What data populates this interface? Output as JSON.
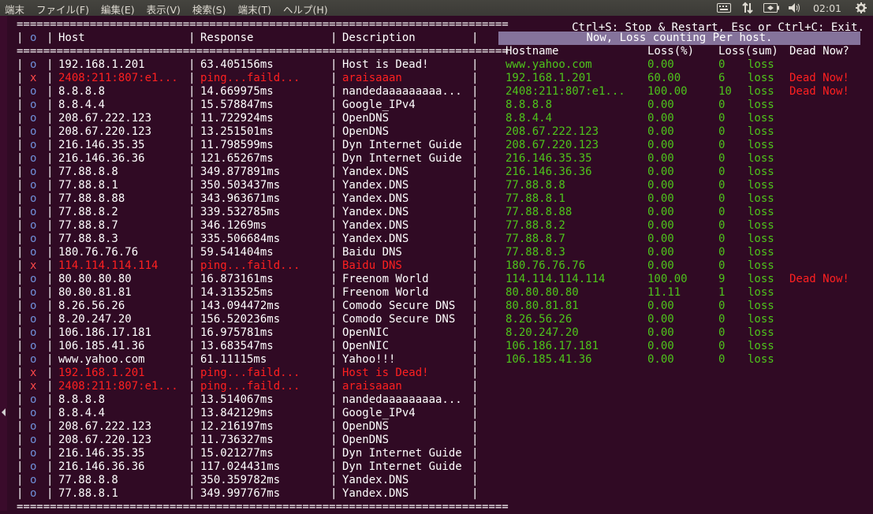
{
  "menubar": {
    "items": [
      "端末",
      "ファイル(F)",
      "編集(E)",
      "表示(V)",
      "検索(S)",
      "端末(T)",
      "ヘルプ(H)"
    ],
    "clock": "02:01"
  },
  "left_table": {
    "separator": "==========================================================================",
    "headers": {
      "mark": "o",
      "host": "Host",
      "response": "Response",
      "description": "Description"
    },
    "rows": [
      {
        "mark": "o",
        "host": "192.168.1.201",
        "response": "63.405156ms",
        "description": "Host is Dead!",
        "dead": false
      },
      {
        "mark": "x",
        "host": "2408:211:807:e1...",
        "response": "ping...faild...",
        "description": "araisaaan",
        "dead": true
      },
      {
        "mark": "o",
        "host": "8.8.8.8",
        "response": "14.669975ms",
        "description": "nandedaaaaaaaaa...",
        "dead": false
      },
      {
        "mark": "o",
        "host": "8.8.4.4",
        "response": "15.578847ms",
        "description": "Google_IPv4",
        "dead": false
      },
      {
        "mark": "o",
        "host": "208.67.222.123",
        "response": "11.722924ms",
        "description": "OpenDNS",
        "dead": false
      },
      {
        "mark": "o",
        "host": "208.67.220.123",
        "response": "13.251501ms",
        "description": "OpenDNS",
        "dead": false
      },
      {
        "mark": "o",
        "host": "216.146.35.35",
        "response": "11.798599ms",
        "description": "Dyn Internet Guide",
        "dead": false
      },
      {
        "mark": "o",
        "host": "216.146.36.36",
        "response": "121.65267ms",
        "description": "Dyn Internet Guide",
        "dead": false
      },
      {
        "mark": "o",
        "host": "77.88.8.8",
        "response": "349.877891ms",
        "description": "Yandex.DNS",
        "dead": false
      },
      {
        "mark": "o",
        "host": "77.88.8.1",
        "response": "350.503437ms",
        "description": "Yandex.DNS",
        "dead": false
      },
      {
        "mark": "o",
        "host": "77.88.8.88",
        "response": "343.963671ms",
        "description": "Yandex.DNS",
        "dead": false
      },
      {
        "mark": "o",
        "host": "77.88.8.2",
        "response": "339.532785ms",
        "description": "Yandex.DNS",
        "dead": false
      },
      {
        "mark": "o",
        "host": "77.88.8.7",
        "response": "346.1269ms",
        "description": "Yandex.DNS",
        "dead": false
      },
      {
        "mark": "o",
        "host": "77.88.8.3",
        "response": "335.506684ms",
        "description": "Yandex.DNS",
        "dead": false
      },
      {
        "mark": "o",
        "host": "180.76.76.76",
        "response": "59.541404ms",
        "description": "Baidu DNS",
        "dead": false
      },
      {
        "mark": "x",
        "host": "114.114.114.114",
        "response": "ping...faild...",
        "description": "Baidu DNS",
        "dead": true
      },
      {
        "mark": "o",
        "host": "80.80.80.80",
        "response": "16.873161ms",
        "description": "Freenom World",
        "dead": false
      },
      {
        "mark": "o",
        "host": "80.80.81.81",
        "response": "14.313525ms",
        "description": "Freenom World",
        "dead": false
      },
      {
        "mark": "o",
        "host": "8.26.56.26",
        "response": "143.094472ms",
        "description": "Comodo Secure DNS",
        "dead": false
      },
      {
        "mark": "o",
        "host": "8.20.247.20",
        "response": "156.520236ms",
        "description": "Comodo Secure DNS",
        "dead": false
      },
      {
        "mark": "o",
        "host": "106.186.17.181",
        "response": "16.975781ms",
        "description": "OpenNIC",
        "dead": false
      },
      {
        "mark": "o",
        "host": "106.185.41.36",
        "response": "13.683547ms",
        "description": "OpenNIC",
        "dead": false
      },
      {
        "mark": "o",
        "host": "www.yahoo.com",
        "response": "61.11115ms",
        "description": "Yahoo!!!",
        "dead": false
      },
      {
        "mark": "x",
        "host": "192.168.1.201",
        "response": "ping...faild...",
        "description": "Host is Dead!",
        "dead": true
      },
      {
        "mark": "x",
        "host": "2408:211:807:e1...",
        "response": "ping...faild...",
        "description": "araisaaan",
        "dead": true
      },
      {
        "mark": "o",
        "host": "8.8.8.8",
        "response": "13.514067ms",
        "description": "nandedaaaaaaaaa...",
        "dead": false
      },
      {
        "mark": "o",
        "host": "8.8.4.4",
        "response": "13.842129ms",
        "description": "Google_IPv4",
        "dead": false
      },
      {
        "mark": "o",
        "host": "208.67.222.123",
        "response": "12.216197ms",
        "description": "OpenDNS",
        "dead": false
      },
      {
        "mark": "o",
        "host": "208.67.220.123",
        "response": "11.736327ms",
        "description": "OpenDNS",
        "dead": false
      },
      {
        "mark": "o",
        "host": "216.146.35.35",
        "response": "15.021277ms",
        "description": "Dyn Internet Guide",
        "dead": false
      },
      {
        "mark": "o",
        "host": "216.146.36.36",
        "response": "117.024431ms",
        "description": "Dyn Internet Guide",
        "dead": false
      },
      {
        "mark": "o",
        "host": "77.88.8.8",
        "response": "350.359782ms",
        "description": "Yandex.DNS",
        "dead": false
      },
      {
        "mark": "o",
        "host": "77.88.8.1",
        "response": "349.997767ms",
        "description": "Yandex.DNS",
        "dead": false
      }
    ]
  },
  "right_panel": {
    "shortcut_text": "Ctrl+S: Stop & Restart, Esc or Ctrl+C: Exit.",
    "banner": "Now, Loss counting Per host.",
    "headers": {
      "hostname": "Hostname",
      "loss_pct": "Loss(%)",
      "loss_sum": "Loss(sum)",
      "dead_now": "Dead Now?"
    },
    "rows": [
      {
        "hostname": "www.yahoo.com",
        "loss_pct": "0.00",
        "loss_sum": "0",
        "unit": "loss",
        "dead_now": ""
      },
      {
        "hostname": "192.168.1.201",
        "loss_pct": "60.00",
        "loss_sum": "6",
        "unit": "loss",
        "dead_now": "Dead Now!"
      },
      {
        "hostname": "2408:211:807:e1...",
        "loss_pct": "100.00",
        "loss_sum": "10",
        "unit": "loss",
        "dead_now": "Dead Now!"
      },
      {
        "hostname": "8.8.8.8",
        "loss_pct": "0.00",
        "loss_sum": "0",
        "unit": "loss",
        "dead_now": ""
      },
      {
        "hostname": "8.8.4.4",
        "loss_pct": "0.00",
        "loss_sum": "0",
        "unit": "loss",
        "dead_now": ""
      },
      {
        "hostname": "208.67.222.123",
        "loss_pct": "0.00",
        "loss_sum": "0",
        "unit": "loss",
        "dead_now": ""
      },
      {
        "hostname": "208.67.220.123",
        "loss_pct": "0.00",
        "loss_sum": "0",
        "unit": "loss",
        "dead_now": ""
      },
      {
        "hostname": "216.146.35.35",
        "loss_pct": "0.00",
        "loss_sum": "0",
        "unit": "loss",
        "dead_now": ""
      },
      {
        "hostname": "216.146.36.36",
        "loss_pct": "0.00",
        "loss_sum": "0",
        "unit": "loss",
        "dead_now": ""
      },
      {
        "hostname": "77.88.8.8",
        "loss_pct": "0.00",
        "loss_sum": "0",
        "unit": "loss",
        "dead_now": ""
      },
      {
        "hostname": "77.88.8.1",
        "loss_pct": "0.00",
        "loss_sum": "0",
        "unit": "loss",
        "dead_now": ""
      },
      {
        "hostname": "77.88.8.88",
        "loss_pct": "0.00",
        "loss_sum": "0",
        "unit": "loss",
        "dead_now": ""
      },
      {
        "hostname": "77.88.8.2",
        "loss_pct": "0.00",
        "loss_sum": "0",
        "unit": "loss",
        "dead_now": ""
      },
      {
        "hostname": "77.88.8.7",
        "loss_pct": "0.00",
        "loss_sum": "0",
        "unit": "loss",
        "dead_now": ""
      },
      {
        "hostname": "77.88.8.3",
        "loss_pct": "0.00",
        "loss_sum": "0",
        "unit": "loss",
        "dead_now": ""
      },
      {
        "hostname": "180.76.76.76",
        "loss_pct": "0.00",
        "loss_sum": "0",
        "unit": "loss",
        "dead_now": ""
      },
      {
        "hostname": "114.114.114.114",
        "loss_pct": "100.00",
        "loss_sum": "9",
        "unit": "loss",
        "dead_now": "Dead Now!"
      },
      {
        "hostname": "80.80.80.80",
        "loss_pct": "11.11",
        "loss_sum": "1",
        "unit": "loss",
        "dead_now": ""
      },
      {
        "hostname": "80.80.81.81",
        "loss_pct": "0.00",
        "loss_sum": "0",
        "unit": "loss",
        "dead_now": ""
      },
      {
        "hostname": "8.26.56.26",
        "loss_pct": "0.00",
        "loss_sum": "0",
        "unit": "loss",
        "dead_now": ""
      },
      {
        "hostname": "8.20.247.20",
        "loss_pct": "0.00",
        "loss_sum": "0",
        "unit": "loss",
        "dead_now": ""
      },
      {
        "hostname": "106.186.17.181",
        "loss_pct": "0.00",
        "loss_sum": "0",
        "unit": "loss",
        "dead_now": ""
      },
      {
        "hostname": "106.185.41.36",
        "loss_pct": "0.00",
        "loss_sum": "0",
        "unit": "loss",
        "dead_now": ""
      }
    ]
  },
  "colors": {
    "terminal_bg": "#300a24",
    "ok_mark": "#6f8fd8",
    "dead": "#ff2020",
    "green": "#4ec41b",
    "banner_bg": "#85739b"
  }
}
